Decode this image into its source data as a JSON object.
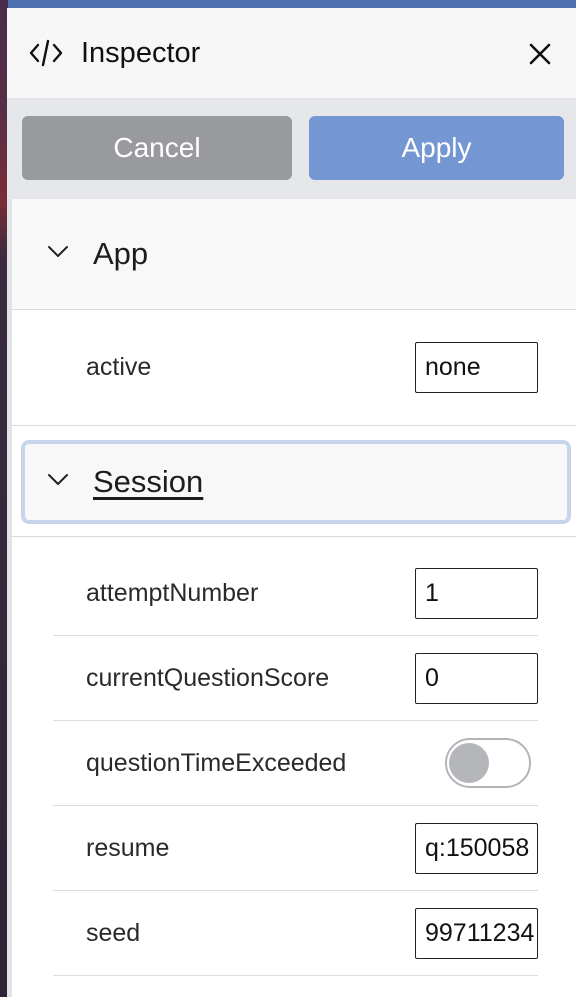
{
  "inspector": {
    "title": "Inspector",
    "icons": {
      "title_icon": "code-icon",
      "close_icon": "close-icon"
    },
    "actions": {
      "cancel_label": "Cancel",
      "apply_label": "Apply"
    },
    "sections": {
      "app": {
        "label": "App",
        "props": [
          {
            "name": "active",
            "value": "none"
          }
        ]
      },
      "session": {
        "label": "Session",
        "props": [
          {
            "name": "attemptNumber",
            "value": "1"
          },
          {
            "name": "currentQuestionScore",
            "value": "0"
          },
          {
            "name": "questionTimeExceeded",
            "type": "toggle",
            "checked": false
          },
          {
            "name": "resume",
            "value": "q:150058"
          },
          {
            "name": "seed",
            "value": "99711234"
          }
        ]
      }
    }
  },
  "colors": {
    "apply": "#7497d4",
    "cancel": "#999a9d",
    "focus_ring": "#c6d4ec"
  }
}
